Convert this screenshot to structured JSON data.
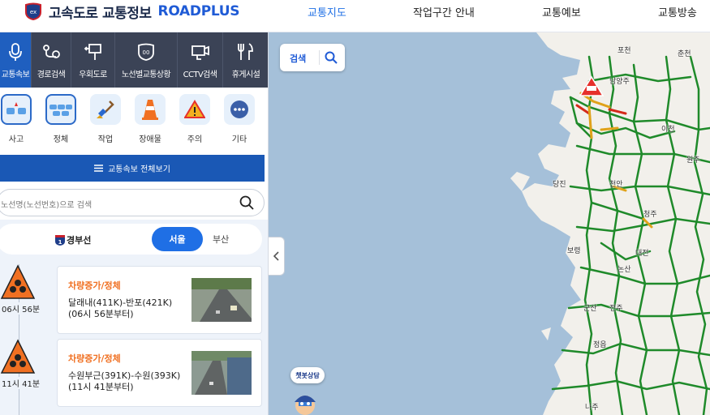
{
  "header": {
    "logo_text": "고속도로 교통정보",
    "logo_brand": "ROADPLUS",
    "nav": [
      {
        "label": "교통지도",
        "active": true
      },
      {
        "label": "작업구간 안내",
        "active": false
      },
      {
        "label": "교통예보",
        "active": false
      },
      {
        "label": "교통방송",
        "active": false
      }
    ]
  },
  "categories": [
    {
      "label": "교통속보",
      "icon": "microphone-icon",
      "active": true
    },
    {
      "label": "경로검색",
      "icon": "route-pin-icon",
      "active": false
    },
    {
      "label": "우회도로",
      "icon": "detour-sign-icon",
      "active": false
    },
    {
      "label": "노선별교통상황",
      "icon": "route-shield-icon",
      "active": false
    },
    {
      "label": "CCTV검색",
      "icon": "cctv-icon",
      "active": false
    },
    {
      "label": "휴게시설",
      "icon": "fork-knife-icon",
      "active": false
    }
  ],
  "incident_types": [
    {
      "label": "사고",
      "icon": "accident-icon",
      "selected": true
    },
    {
      "label": "정체",
      "icon": "congestion-icon",
      "selected": true
    },
    {
      "label": "작업",
      "icon": "shovel-icon",
      "selected": false
    },
    {
      "label": "장애물",
      "icon": "traffic-cone-icon",
      "selected": false
    },
    {
      "label": "주의",
      "icon": "warning-icon",
      "selected": false
    },
    {
      "label": "기타",
      "icon": "more-icon",
      "selected": false
    }
  ],
  "all_button_label": "교통속보 전체보기",
  "search": {
    "placeholder": "노선명(노선번호)으로 검색"
  },
  "route": {
    "number": "1",
    "name": "경부선",
    "directions": [
      {
        "label": "서울",
        "active": true
      },
      {
        "label": "부산",
        "active": false
      }
    ]
  },
  "incidents": [
    {
      "time": "06시 56분",
      "title": "차량증가/정체",
      "section": "달래내(411K)-반포(421K)",
      "since": "(06시 56분부터)"
    },
    {
      "time": "11시 41분",
      "title": "차량증가/정체",
      "section": "수원부근(391K)-수원(393K)",
      "since": "(11시 41분부터)"
    }
  ],
  "map": {
    "search_label": "검색",
    "chatbot_label": "챗봇상담",
    "cities": [
      "포천",
      "춘천",
      "남양주",
      "이천",
      "원주",
      "당진",
      "천안",
      "청주",
      "보령",
      "대전",
      "논산",
      "군산",
      "전주",
      "정읍",
      "나주"
    ]
  },
  "colors": {
    "accent": "#1f6fe5",
    "panel_dark": "#3b4356",
    "incident_orange": "#f07022",
    "road_green": "#1f8a2a",
    "sea": "#a5c0d9",
    "land": "#f3f1ec"
  }
}
